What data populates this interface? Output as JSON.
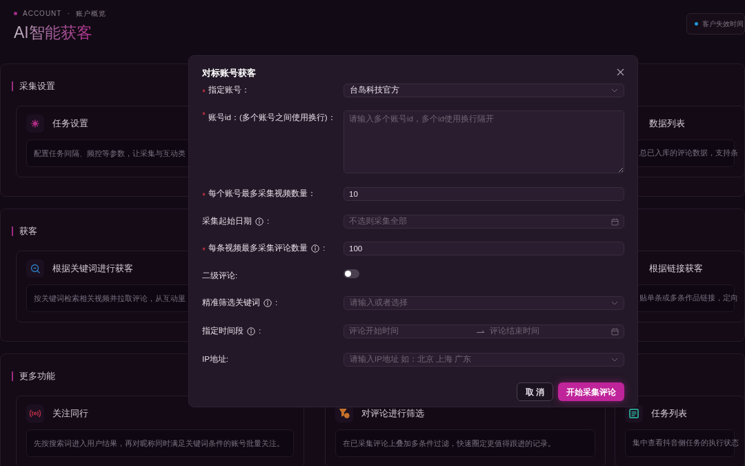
{
  "header": {
    "breadcrumb": [
      "ACCOUNT",
      "·",
      "账户概览"
    ],
    "title": "AI智能获客",
    "expiry": {
      "label": "客户失效时间",
      "color": "#1e9bd7"
    }
  },
  "sections": [
    {
      "title": "采集设置",
      "cards": [
        {
          "kind": "card",
          "title": "任务设置",
          "desc": "配置任务间隔、频控等参数，让采集与互动类",
          "color": "#b02d86"
        },
        {
          "kind": "partial",
          "title": "数据列表",
          "desc": "总已入库的评论数据，支持条"
        }
      ]
    },
    {
      "title": "获客",
      "cards": [
        {
          "kind": "card",
          "title": "根据关键词进行获客",
          "desc": "按关键词检索相关视频并拉取评论，从互动里",
          "color": "#2f7fc4"
        },
        {
          "kind": "partial",
          "title": "根据链接获客",
          "desc": "贴单条或多条作品链接，定向"
        }
      ]
    },
    {
      "title": "更多功能",
      "cards": [
        {
          "kind": "card",
          "title": "关注同行",
          "desc": "先按搜索词进入用户结果，再对昵称同时满足关键词条件的账号批量关注。",
          "color": "#c0304a"
        },
        {
          "kind": "card",
          "title": "对评论进行筛选",
          "desc": "在已采集评论上叠加多条件过滤，快速圈定更值得跟进的记录。",
          "color": "#c5702a"
        },
        {
          "kind": "card",
          "title": "任务列表",
          "desc": "集中查看抖音侧任务的执行状态",
          "color": "#2a9a8c"
        }
      ]
    }
  ],
  "dialog": {
    "title": "对标账号获客",
    "fields": [
      {
        "kind": "select",
        "label": "指定账号：",
        "required": true,
        "value": "台岛科技官方"
      },
      {
        "kind": "textarea",
        "label": "账号id：(多个账号之间使用换行)：",
        "required": true,
        "placeholder": "请输入多个账号id，多个id使用换行隔开"
      },
      {
        "kind": "input",
        "label": "每个账号最多采集视频数量：",
        "required": true,
        "value": "10"
      },
      {
        "kind": "date",
        "label": "采集起始日期",
        "info": true,
        "suffix": ":",
        "required": false,
        "placeholder": "不选则采集全部"
      },
      {
        "kind": "input",
        "label": "每条视频最多采集评论数量",
        "info": true,
        "suffix": ":",
        "required": true,
        "value": "100"
      },
      {
        "kind": "switch",
        "label": "二级评论:",
        "required": false,
        "on": false
      },
      {
        "kind": "select",
        "label": "精准筛选关键词",
        "info": true,
        "suffix": ":",
        "required": false,
        "placeholder": "请输入或者选择"
      },
      {
        "kind": "range",
        "label": "指定时间段",
        "info": true,
        "suffix": ":",
        "required": false,
        "start_placeholder": "评论开始时间",
        "end_placeholder": "评论结束时间"
      },
      {
        "kind": "select",
        "label": "IP地址:",
        "required": false,
        "placeholder": "请输入IP地址 如：北京 上海 广东"
      }
    ],
    "buttons": [
      {
        "label": "取 消",
        "primary": false
      },
      {
        "label": "开始采集评论",
        "primary": true
      }
    ]
  }
}
